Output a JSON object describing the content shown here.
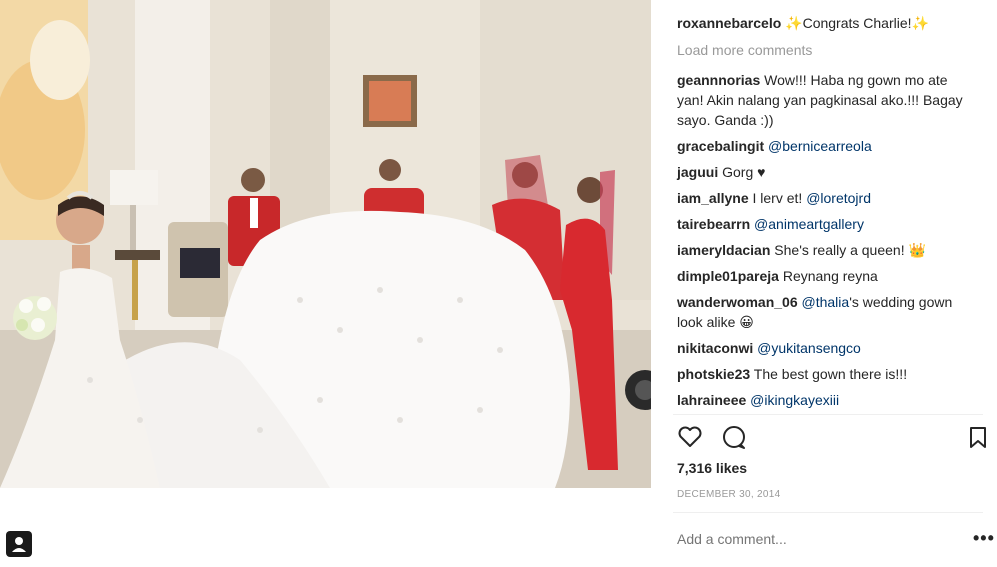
{
  "post": {
    "image_alt": "Bride in a white gown with a long train held by bridesmaids in red",
    "caption": {
      "username": "roxannebarcelo",
      "text": "✨Congrats Charlie!✨"
    },
    "load_more_label": "Load more comments",
    "comments": [
      {
        "username": "geannnorias",
        "text": "Wow!!! Haba ng gown mo ate yan! Akin nalang yan pagkinasal ako.!!! Bagay sayo. Ganda :))"
      },
      {
        "username": "gracebalingit",
        "mention": "@bernicearreola"
      },
      {
        "username": "jaguui",
        "text": "Gorg ♥"
      },
      {
        "username": "iam_allyne",
        "text": "I lerv et! ",
        "mention": "@loretojrd"
      },
      {
        "username": "tairebearrn",
        "mention": "@animeartgallery"
      },
      {
        "username": "iameryldacian",
        "text": "She's really a queen! 👑"
      },
      {
        "username": "dimple01pareja",
        "text": "Reynang reyna"
      },
      {
        "username": "wanderwoman_06",
        "mention": "@thalia",
        "text": "'s wedding gown look alike 😀"
      },
      {
        "username": "nikitaconwi",
        "mention": "@yukitansengco"
      },
      {
        "username": "photskie23",
        "text": "The best gown there is!!!"
      },
      {
        "username": "lahraineee",
        "mention": "@ikingkayexiii"
      }
    ],
    "likes": "7,316 likes",
    "date": "DECEMBER 30, 2014",
    "add_comment_placeholder": "Add a comment...",
    "more_options": "•••"
  }
}
